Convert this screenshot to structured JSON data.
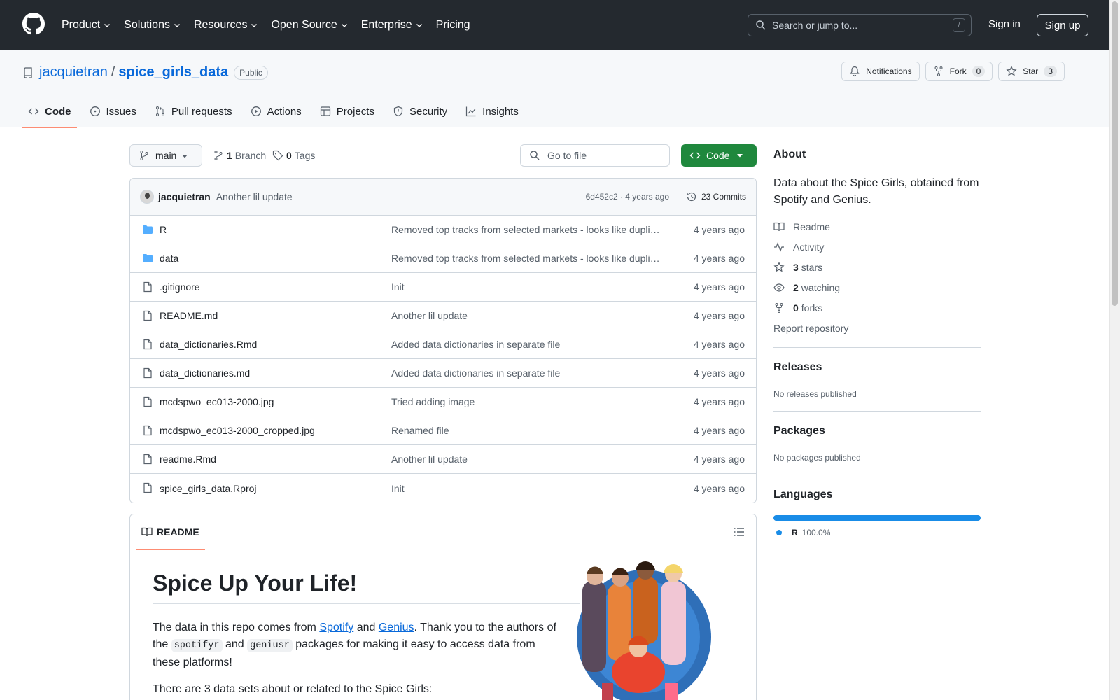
{
  "header": {
    "nav": [
      "Product",
      "Solutions",
      "Resources",
      "Open Source",
      "Enterprise",
      "Pricing"
    ],
    "search_placeholder": "Search or jump to...",
    "search_shortcut": "/",
    "sign_in": "Sign in",
    "sign_up": "Sign up"
  },
  "repo": {
    "owner": "jacquietran",
    "separator": "/",
    "name": "spice_girls_data",
    "visibility": "Public",
    "notifications": "Notifications",
    "fork": "Fork",
    "fork_count": "0",
    "star": "Star",
    "star_count": "3",
    "tabs": [
      "Code",
      "Issues",
      "Pull requests",
      "Actions",
      "Projects",
      "Security",
      "Insights"
    ]
  },
  "toolbar": {
    "branch": "main",
    "branch_count": "1",
    "branch_label": "Branch",
    "tag_count": "0",
    "tag_label": "Tags",
    "goto_file": "Go to file",
    "code_button": "Code"
  },
  "latest_commit": {
    "author": "jacquietran",
    "message": "Another lil update",
    "sha_time": "6d452c2 · 4 years ago",
    "commits": "23 Commits"
  },
  "files": [
    {
      "type": "folder",
      "name": "R",
      "message": "Removed top tracks from selected markets - looks like dupli…",
      "time": "4 years ago"
    },
    {
      "type": "folder",
      "name": "data",
      "message": "Removed top tracks from selected markets - looks like dupli…",
      "time": "4 years ago"
    },
    {
      "type": "file",
      "name": ".gitignore",
      "message": "Init",
      "time": "4 years ago"
    },
    {
      "type": "file",
      "name": "README.md",
      "message": "Another lil update",
      "time": "4 years ago"
    },
    {
      "type": "file",
      "name": "data_dictionaries.Rmd",
      "message": "Added data dictionaries in separate file",
      "time": "4 years ago"
    },
    {
      "type": "file",
      "name": "data_dictionaries.md",
      "message": "Added data dictionaries in separate file",
      "time": "4 years ago"
    },
    {
      "type": "file",
      "name": "mcdspwo_ec013-2000.jpg",
      "message": "Tried adding image",
      "time": "4 years ago"
    },
    {
      "type": "file",
      "name": "mcdspwo_ec013-2000_cropped.jpg",
      "message": "Renamed file",
      "time": "4 years ago"
    },
    {
      "type": "file",
      "name": "readme.Rmd",
      "message": "Another lil update",
      "time": "4 years ago"
    },
    {
      "type": "file",
      "name": "spice_girls_data.Rproj",
      "message": "Init",
      "time": "4 years ago"
    }
  ],
  "readme": {
    "tab": "README",
    "title": "Spice Up Your Life!",
    "p1_a": "The data in this repo comes from ",
    "link_spotify": "Spotify",
    "p1_b": " and ",
    "link_genius": "Genius",
    "p1_c": ". Thank you to the authors of the ",
    "code_spotifyr": "spotifyr",
    "p1_d": " and ",
    "code_geniusr": "geniusr",
    "p1_e": " packages for making it easy to access data from these platforms!",
    "p2": "There are 3 data sets about or related to the Spice Girls:"
  },
  "sidebar": {
    "about_title": "About",
    "description": "Data about the Spice Girls, obtained from Spotify and Genius.",
    "readme": "Readme",
    "activity": "Activity",
    "stars_count": "3",
    "stars_label": "stars",
    "watching_count": "2",
    "watching_label": "watching",
    "forks_count": "0",
    "forks_label": "forks",
    "report": "Report repository",
    "releases_title": "Releases",
    "releases_sub": "No releases published",
    "packages_title": "Packages",
    "packages_sub": "No packages published",
    "languages_title": "Languages",
    "language_name": "R",
    "language_pct": "100.0%"
  },
  "colors": {
    "header_bg": "#24292f",
    "accent_blue": "#0969da",
    "code_green": "#1f883d",
    "tab_underline": "#fd8c73",
    "lang_r": "#198ce7"
  }
}
